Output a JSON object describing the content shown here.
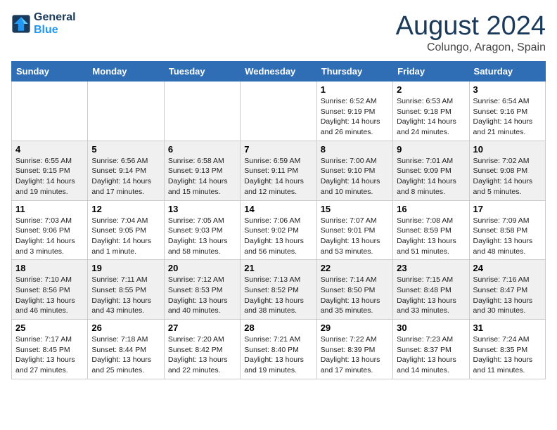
{
  "logo": {
    "line1": "General",
    "line2": "Blue"
  },
  "title": "August 2024",
  "subtitle": "Colungo, Aragon, Spain",
  "days_of_week": [
    "Sunday",
    "Monday",
    "Tuesday",
    "Wednesday",
    "Thursday",
    "Friday",
    "Saturday"
  ],
  "weeks": [
    [
      {
        "day": "",
        "info": ""
      },
      {
        "day": "",
        "info": ""
      },
      {
        "day": "",
        "info": ""
      },
      {
        "day": "",
        "info": ""
      },
      {
        "day": "1",
        "info": "Sunrise: 6:52 AM\nSunset: 9:19 PM\nDaylight: 14 hours\nand 26 minutes."
      },
      {
        "day": "2",
        "info": "Sunrise: 6:53 AM\nSunset: 9:18 PM\nDaylight: 14 hours\nand 24 minutes."
      },
      {
        "day": "3",
        "info": "Sunrise: 6:54 AM\nSunset: 9:16 PM\nDaylight: 14 hours\nand 21 minutes."
      }
    ],
    [
      {
        "day": "4",
        "info": "Sunrise: 6:55 AM\nSunset: 9:15 PM\nDaylight: 14 hours\nand 19 minutes."
      },
      {
        "day": "5",
        "info": "Sunrise: 6:56 AM\nSunset: 9:14 PM\nDaylight: 14 hours\nand 17 minutes."
      },
      {
        "day": "6",
        "info": "Sunrise: 6:58 AM\nSunset: 9:13 PM\nDaylight: 14 hours\nand 15 minutes."
      },
      {
        "day": "7",
        "info": "Sunrise: 6:59 AM\nSunset: 9:11 PM\nDaylight: 14 hours\nand 12 minutes."
      },
      {
        "day": "8",
        "info": "Sunrise: 7:00 AM\nSunset: 9:10 PM\nDaylight: 14 hours\nand 10 minutes."
      },
      {
        "day": "9",
        "info": "Sunrise: 7:01 AM\nSunset: 9:09 PM\nDaylight: 14 hours\nand 8 minutes."
      },
      {
        "day": "10",
        "info": "Sunrise: 7:02 AM\nSunset: 9:08 PM\nDaylight: 14 hours\nand 5 minutes."
      }
    ],
    [
      {
        "day": "11",
        "info": "Sunrise: 7:03 AM\nSunset: 9:06 PM\nDaylight: 14 hours\nand 3 minutes."
      },
      {
        "day": "12",
        "info": "Sunrise: 7:04 AM\nSunset: 9:05 PM\nDaylight: 14 hours\nand 1 minute."
      },
      {
        "day": "13",
        "info": "Sunrise: 7:05 AM\nSunset: 9:03 PM\nDaylight: 13 hours\nand 58 minutes."
      },
      {
        "day": "14",
        "info": "Sunrise: 7:06 AM\nSunset: 9:02 PM\nDaylight: 13 hours\nand 56 minutes."
      },
      {
        "day": "15",
        "info": "Sunrise: 7:07 AM\nSunset: 9:01 PM\nDaylight: 13 hours\nand 53 minutes."
      },
      {
        "day": "16",
        "info": "Sunrise: 7:08 AM\nSunset: 8:59 PM\nDaylight: 13 hours\nand 51 minutes."
      },
      {
        "day": "17",
        "info": "Sunrise: 7:09 AM\nSunset: 8:58 PM\nDaylight: 13 hours\nand 48 minutes."
      }
    ],
    [
      {
        "day": "18",
        "info": "Sunrise: 7:10 AM\nSunset: 8:56 PM\nDaylight: 13 hours\nand 46 minutes."
      },
      {
        "day": "19",
        "info": "Sunrise: 7:11 AM\nSunset: 8:55 PM\nDaylight: 13 hours\nand 43 minutes."
      },
      {
        "day": "20",
        "info": "Sunrise: 7:12 AM\nSunset: 8:53 PM\nDaylight: 13 hours\nand 40 minutes."
      },
      {
        "day": "21",
        "info": "Sunrise: 7:13 AM\nSunset: 8:52 PM\nDaylight: 13 hours\nand 38 minutes."
      },
      {
        "day": "22",
        "info": "Sunrise: 7:14 AM\nSunset: 8:50 PM\nDaylight: 13 hours\nand 35 minutes."
      },
      {
        "day": "23",
        "info": "Sunrise: 7:15 AM\nSunset: 8:48 PM\nDaylight: 13 hours\nand 33 minutes."
      },
      {
        "day": "24",
        "info": "Sunrise: 7:16 AM\nSunset: 8:47 PM\nDaylight: 13 hours\nand 30 minutes."
      }
    ],
    [
      {
        "day": "25",
        "info": "Sunrise: 7:17 AM\nSunset: 8:45 PM\nDaylight: 13 hours\nand 27 minutes."
      },
      {
        "day": "26",
        "info": "Sunrise: 7:18 AM\nSunset: 8:44 PM\nDaylight: 13 hours\nand 25 minutes."
      },
      {
        "day": "27",
        "info": "Sunrise: 7:20 AM\nSunset: 8:42 PM\nDaylight: 13 hours\nand 22 minutes."
      },
      {
        "day": "28",
        "info": "Sunrise: 7:21 AM\nSunset: 8:40 PM\nDaylight: 13 hours\nand 19 minutes."
      },
      {
        "day": "29",
        "info": "Sunrise: 7:22 AM\nSunset: 8:39 PM\nDaylight: 13 hours\nand 17 minutes."
      },
      {
        "day": "30",
        "info": "Sunrise: 7:23 AM\nSunset: 8:37 PM\nDaylight: 13 hours\nand 14 minutes."
      },
      {
        "day": "31",
        "info": "Sunrise: 7:24 AM\nSunset: 8:35 PM\nDaylight: 13 hours\nand 11 minutes."
      }
    ]
  ]
}
